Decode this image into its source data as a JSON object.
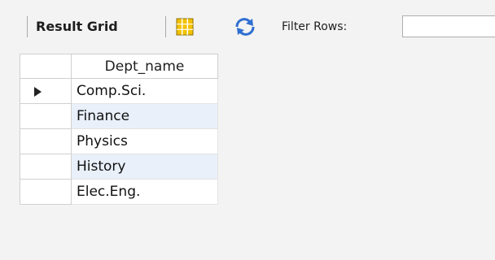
{
  "toolbar": {
    "title": "Result Grid",
    "filter_label": "Filter Rows:",
    "filter_value": "",
    "icons": {
      "grid": "grid-view-icon",
      "refresh": "refresh-icon"
    }
  },
  "grid": {
    "columns": [
      "Dept_name"
    ],
    "rows": [
      {
        "dept_name": "Comp.Sci.",
        "current": true
      },
      {
        "dept_name": "Finance",
        "current": false
      },
      {
        "dept_name": "Physics",
        "current": false
      },
      {
        "dept_name": "History",
        "current": false
      },
      {
        "dept_name": "Elec.Eng.",
        "current": false
      }
    ]
  },
  "colors": {
    "alt_row": "#e9f0fa",
    "grid_icon_fill": "#f2c200",
    "refresh_icon": "#2f6fd1"
  }
}
